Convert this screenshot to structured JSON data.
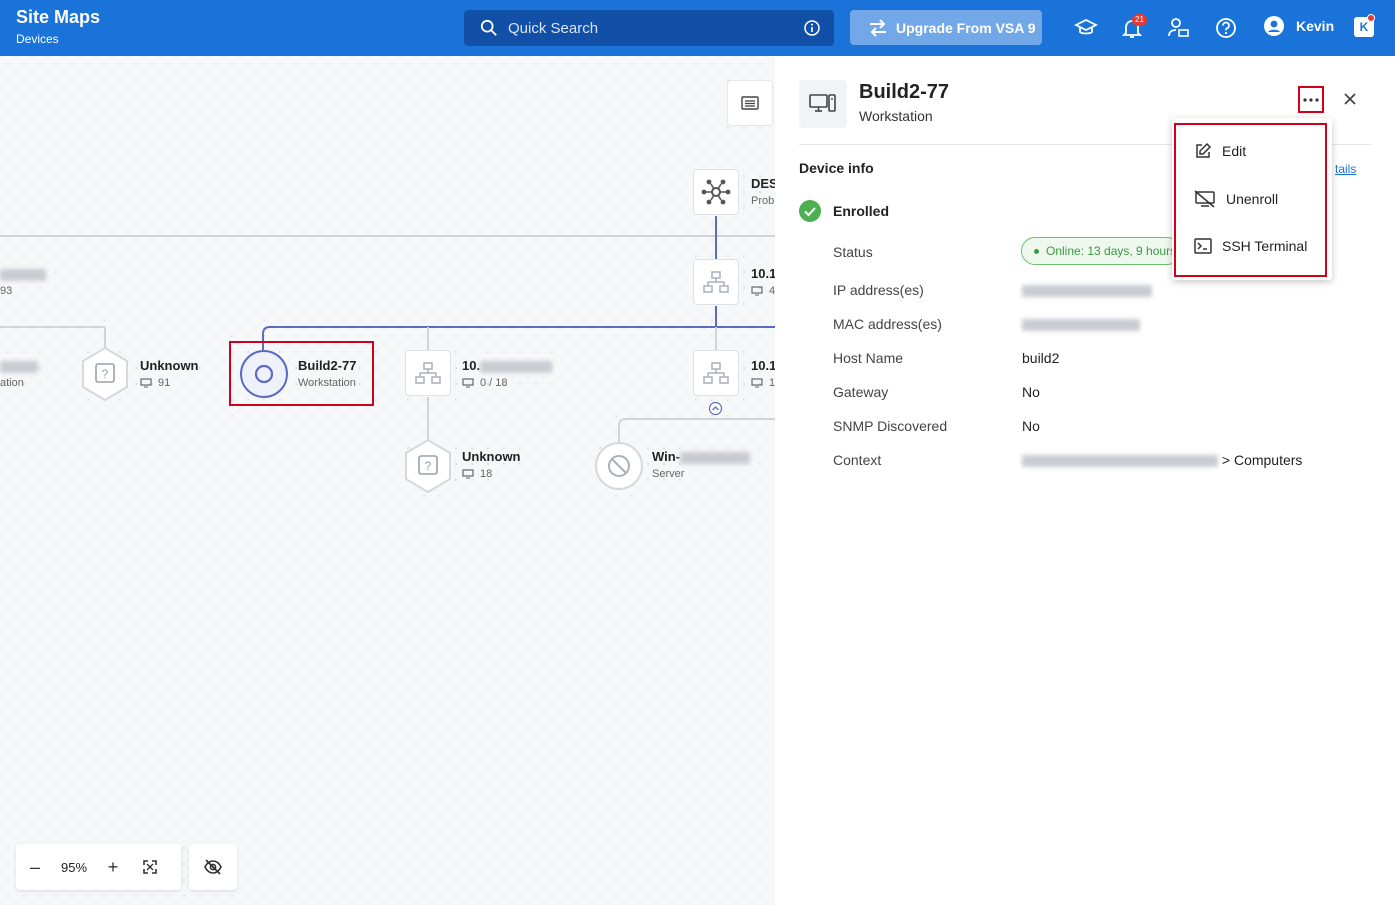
{
  "header": {
    "title": "Site Maps",
    "subtitle": "Devices",
    "search_placeholder": "Quick Search",
    "upgrade_label": "Upgrade From VSA 9",
    "notification_count": "21",
    "user_name": "Kevin",
    "brand_color": "#1a73d9"
  },
  "map": {
    "nodes": {
      "partial_left_top": {
        "sub": "93"
      },
      "partial_left_mid": {
        "sub": "ation"
      },
      "unknown_1": {
        "name": "Unknown",
        "count": "91"
      },
      "build2": {
        "name": "Build2-77",
        "type": "Workstation"
      },
      "switch_mid": {
        "name_prefix": "10.",
        "count": "0 / 18"
      },
      "unknown_2": {
        "name": "Unknown",
        "count": "18"
      },
      "win_server": {
        "name_prefix": "Win-",
        "type": "Server"
      },
      "probe": {
        "name": "DES",
        "type": "Prob"
      },
      "switch_top_right": {
        "name": "10.1",
        "count": "4"
      },
      "switch_mid_right": {
        "name": "10.1",
        "count": "1"
      }
    },
    "zoom": "95%",
    "zoom_out": "–",
    "zoom_in": "+"
  },
  "panel": {
    "device_name": "Build2-77",
    "device_type": "Workstation",
    "section_title": "Device info",
    "details_link": "tails",
    "enrolled_label": "Enrolled",
    "fields": [
      {
        "label": "Status",
        "value": "Online: 13 days, 9 hours"
      },
      {
        "label": "IP address(es)",
        "value": ""
      },
      {
        "label": "MAC address(es)",
        "value": ""
      },
      {
        "label": "Host Name",
        "value": "build2"
      },
      {
        "label": "Gateway",
        "value": "No"
      },
      {
        "label": "SNMP Discovered",
        "value": "No"
      },
      {
        "label": "Context",
        "value": "> Computers"
      }
    ]
  },
  "menu": {
    "items": [
      {
        "label": "Edit",
        "icon": "edit-icon"
      },
      {
        "label": "Unenroll",
        "icon": "unenroll-icon"
      },
      {
        "label": "SSH Terminal",
        "icon": "terminal-icon"
      }
    ]
  }
}
